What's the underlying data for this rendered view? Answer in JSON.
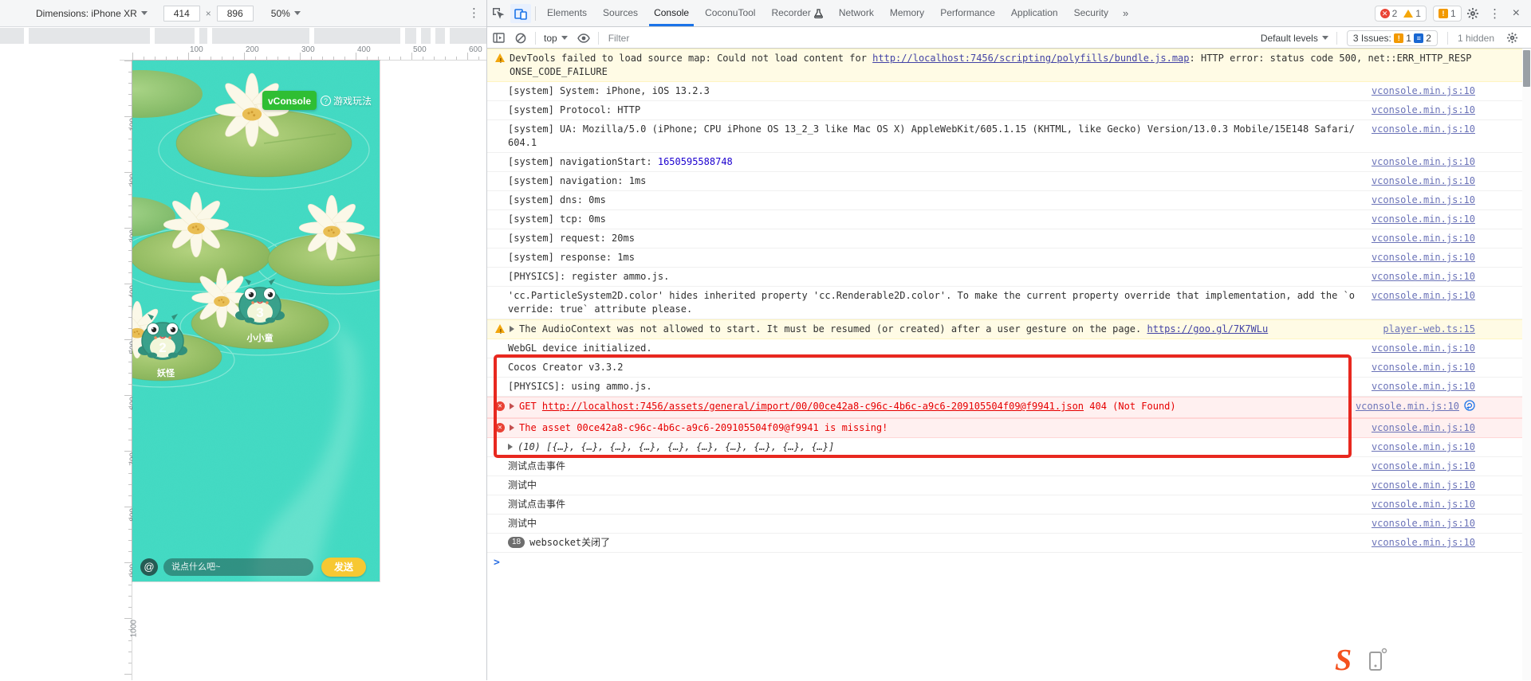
{
  "colors": {
    "accent_blue": "#1a73e8",
    "annotation_red": "#e8281f",
    "vconsole_green": "#2fbe33",
    "send_yellow": "#f7c832",
    "pond_teal": "#41d9c2",
    "error_red": "#e60000",
    "link_slate": "#6b73b8"
  },
  "icons": {
    "overflow_menu": "⋮",
    "more_tabs": "»",
    "close": "×",
    "at": "@",
    "prompt": ">",
    "help": "?"
  },
  "device_toolbar": {
    "dimensions_label": "Dimensions:",
    "device_name": "iPhone XR",
    "width": "414",
    "dim_sep": "×",
    "height": "896",
    "zoom": "50%"
  },
  "rulers": {
    "h_labels": [
      "100",
      "200",
      "300",
      "400",
      "500",
      "600"
    ],
    "v_labels": [
      "100",
      "200",
      "300",
      "400",
      "500",
      "600",
      "700",
      "800",
      "900",
      "1000"
    ]
  },
  "game": {
    "vconsole_label": "vConsole",
    "help_label": "游戏玩法",
    "frogs": [
      {
        "number": "3",
        "name": "小小童"
      },
      {
        "number": "2",
        "name": "妖怪"
      }
    ],
    "chat": {
      "placeholder": "说点什么吧~",
      "send_label": "发送"
    }
  },
  "floating_logo_letter": "S",
  "devtools": {
    "tabs": [
      "Elements",
      "Sources",
      "Console",
      "CoconuTool",
      "Recorder",
      "Network",
      "Memory",
      "Performance",
      "Application",
      "Security"
    ],
    "active_tab": "Console",
    "badges": {
      "errors": "2",
      "warnings": "1",
      "issues": "1"
    },
    "console_toolbar": {
      "context_label": "top",
      "filter_placeholder": "Filter",
      "levels_label": "Default levels",
      "issues_label": "3 Issues:",
      "issue_error_count": "1",
      "issue_info_count": "2",
      "hidden_label": "1 hidden"
    },
    "messages": [
      {
        "level": "warn",
        "parts": [
          {
            "t": "text",
            "v": "DevTools failed to load source map: Could not load content for "
          },
          {
            "t": "link",
            "v": "http://localhost:7456/scripting/polyfills/bundle.js.map"
          },
          {
            "t": "text",
            "v": ": HTTP error: status code 500, net::ERR_HTTP_RESPONSE_CODE_FAILURE"
          }
        ],
        "source": ""
      },
      {
        "level": "log",
        "parts": [
          {
            "t": "text",
            "v": "[system] System: iPhone, iOS 13.2.3"
          }
        ],
        "source": "vconsole.min.js:10"
      },
      {
        "level": "log",
        "parts": [
          {
            "t": "text",
            "v": "[system] Protocol: HTTP"
          }
        ],
        "source": "vconsole.min.js:10"
      },
      {
        "level": "log",
        "parts": [
          {
            "t": "text",
            "v": "[system] UA: Mozilla/5.0 (iPhone; CPU iPhone OS 13_2_3 like Mac OS X) AppleWebKit/605.1.15 (KHTML, like Gecko) Version/13.0.3 Mobile/15E148 Safari/604.1"
          }
        ],
        "source": "vconsole.min.js:10"
      },
      {
        "level": "log",
        "parts": [
          {
            "t": "text",
            "v": "[system] navigationStart: "
          },
          {
            "t": "number",
            "v": "1650595588748"
          }
        ],
        "source": "vconsole.min.js:10"
      },
      {
        "level": "log",
        "parts": [
          {
            "t": "text",
            "v": "[system] navigation: 1ms"
          }
        ],
        "source": "vconsole.min.js:10"
      },
      {
        "level": "log",
        "parts": [
          {
            "t": "text",
            "v": "[system] dns: 0ms"
          }
        ],
        "source": "vconsole.min.js:10"
      },
      {
        "level": "log",
        "parts": [
          {
            "t": "text",
            "v": "[system] tcp: 0ms"
          }
        ],
        "source": "vconsole.min.js:10"
      },
      {
        "level": "log",
        "parts": [
          {
            "t": "text",
            "v": "[system] request: 20ms"
          }
        ],
        "source": "vconsole.min.js:10"
      },
      {
        "level": "log",
        "parts": [
          {
            "t": "text",
            "v": "[system] response: 1ms"
          }
        ],
        "source": "vconsole.min.js:10"
      },
      {
        "level": "log",
        "parts": [
          {
            "t": "text",
            "v": "[PHYSICS]: register ammo.js."
          }
        ],
        "source": "vconsole.min.js:10"
      },
      {
        "level": "log",
        "parts": [
          {
            "t": "text",
            "v": "'cc.ParticleSystem2D.color' hides inherited property 'cc.Renderable2D.color'. To make the current property override that implementation, add the `override: true` attribute please."
          }
        ],
        "source": "vconsole.min.js:10"
      },
      {
        "level": "warn",
        "arrow": true,
        "parts": [
          {
            "t": "text",
            "v": "The AudioContext was not allowed to start. It must be resumed (or created) after a user gesture on the page. "
          },
          {
            "t": "link",
            "v": "https://goo.gl/7K7WLu"
          }
        ],
        "source": "player-web.ts:15"
      },
      {
        "level": "log",
        "parts": [
          {
            "t": "text",
            "v": "WebGL device initialized."
          }
        ],
        "source": "vconsole.min.js:10"
      },
      {
        "level": "log",
        "boxed": true,
        "parts": [
          {
            "t": "text",
            "v": "Cocos Creator v3.3.2"
          }
        ],
        "source": "vconsole.min.js:10"
      },
      {
        "level": "log",
        "boxed": true,
        "parts": [
          {
            "t": "text",
            "v": "[PHYSICS]: using ammo.js."
          }
        ],
        "source": "vconsole.min.js:10"
      },
      {
        "level": "error",
        "boxed": true,
        "arrow": true,
        "parts": [
          {
            "t": "text",
            "v": "GET "
          },
          {
            "t": "errlink",
            "v": "http://localhost:7456/assets/general/import/00/00ce42a8-c96c-4b6c-a9c6-209105504f09@f9941.json"
          },
          {
            "t": "text",
            "v": " 404 (Not Found)"
          }
        ],
        "source": "vconsole.min.js:10",
        "source_icon": "reload"
      },
      {
        "level": "error",
        "boxed": true,
        "arrow": true,
        "parts": [
          {
            "t": "text",
            "v": "The asset 00ce42a8-c96c-4b6c-a9c6-209105504f09@f9941 is missing!"
          }
        ],
        "source": "vconsole.min.js:10"
      },
      {
        "level": "log",
        "boxed": true,
        "arrow": true,
        "parts": [
          {
            "t": "italic",
            "v": "(10) [{…}, {…}, {…}, {…}, {…}, {…}, {…}, {…}, {…}, {…}]"
          }
        ],
        "source": "vconsole.min.js:10"
      },
      {
        "level": "log",
        "parts": [
          {
            "t": "text",
            "v": "测试点击事件"
          }
        ],
        "source": "vconsole.min.js:10"
      },
      {
        "level": "log",
        "parts": [
          {
            "t": "text",
            "v": "测试中"
          }
        ],
        "source": "vconsole.min.js:10"
      },
      {
        "level": "log",
        "parts": [
          {
            "t": "text",
            "v": "测试点击事件"
          }
        ],
        "source": "vconsole.min.js:10"
      },
      {
        "level": "log",
        "parts": [
          {
            "t": "text",
            "v": "测试中"
          }
        ],
        "source": "vconsole.min.js:10"
      },
      {
        "level": "log",
        "badge": "18",
        "parts": [
          {
            "t": "text",
            "v": "websocket关闭了"
          }
        ],
        "source": "vconsole.min.js:10"
      }
    ]
  }
}
